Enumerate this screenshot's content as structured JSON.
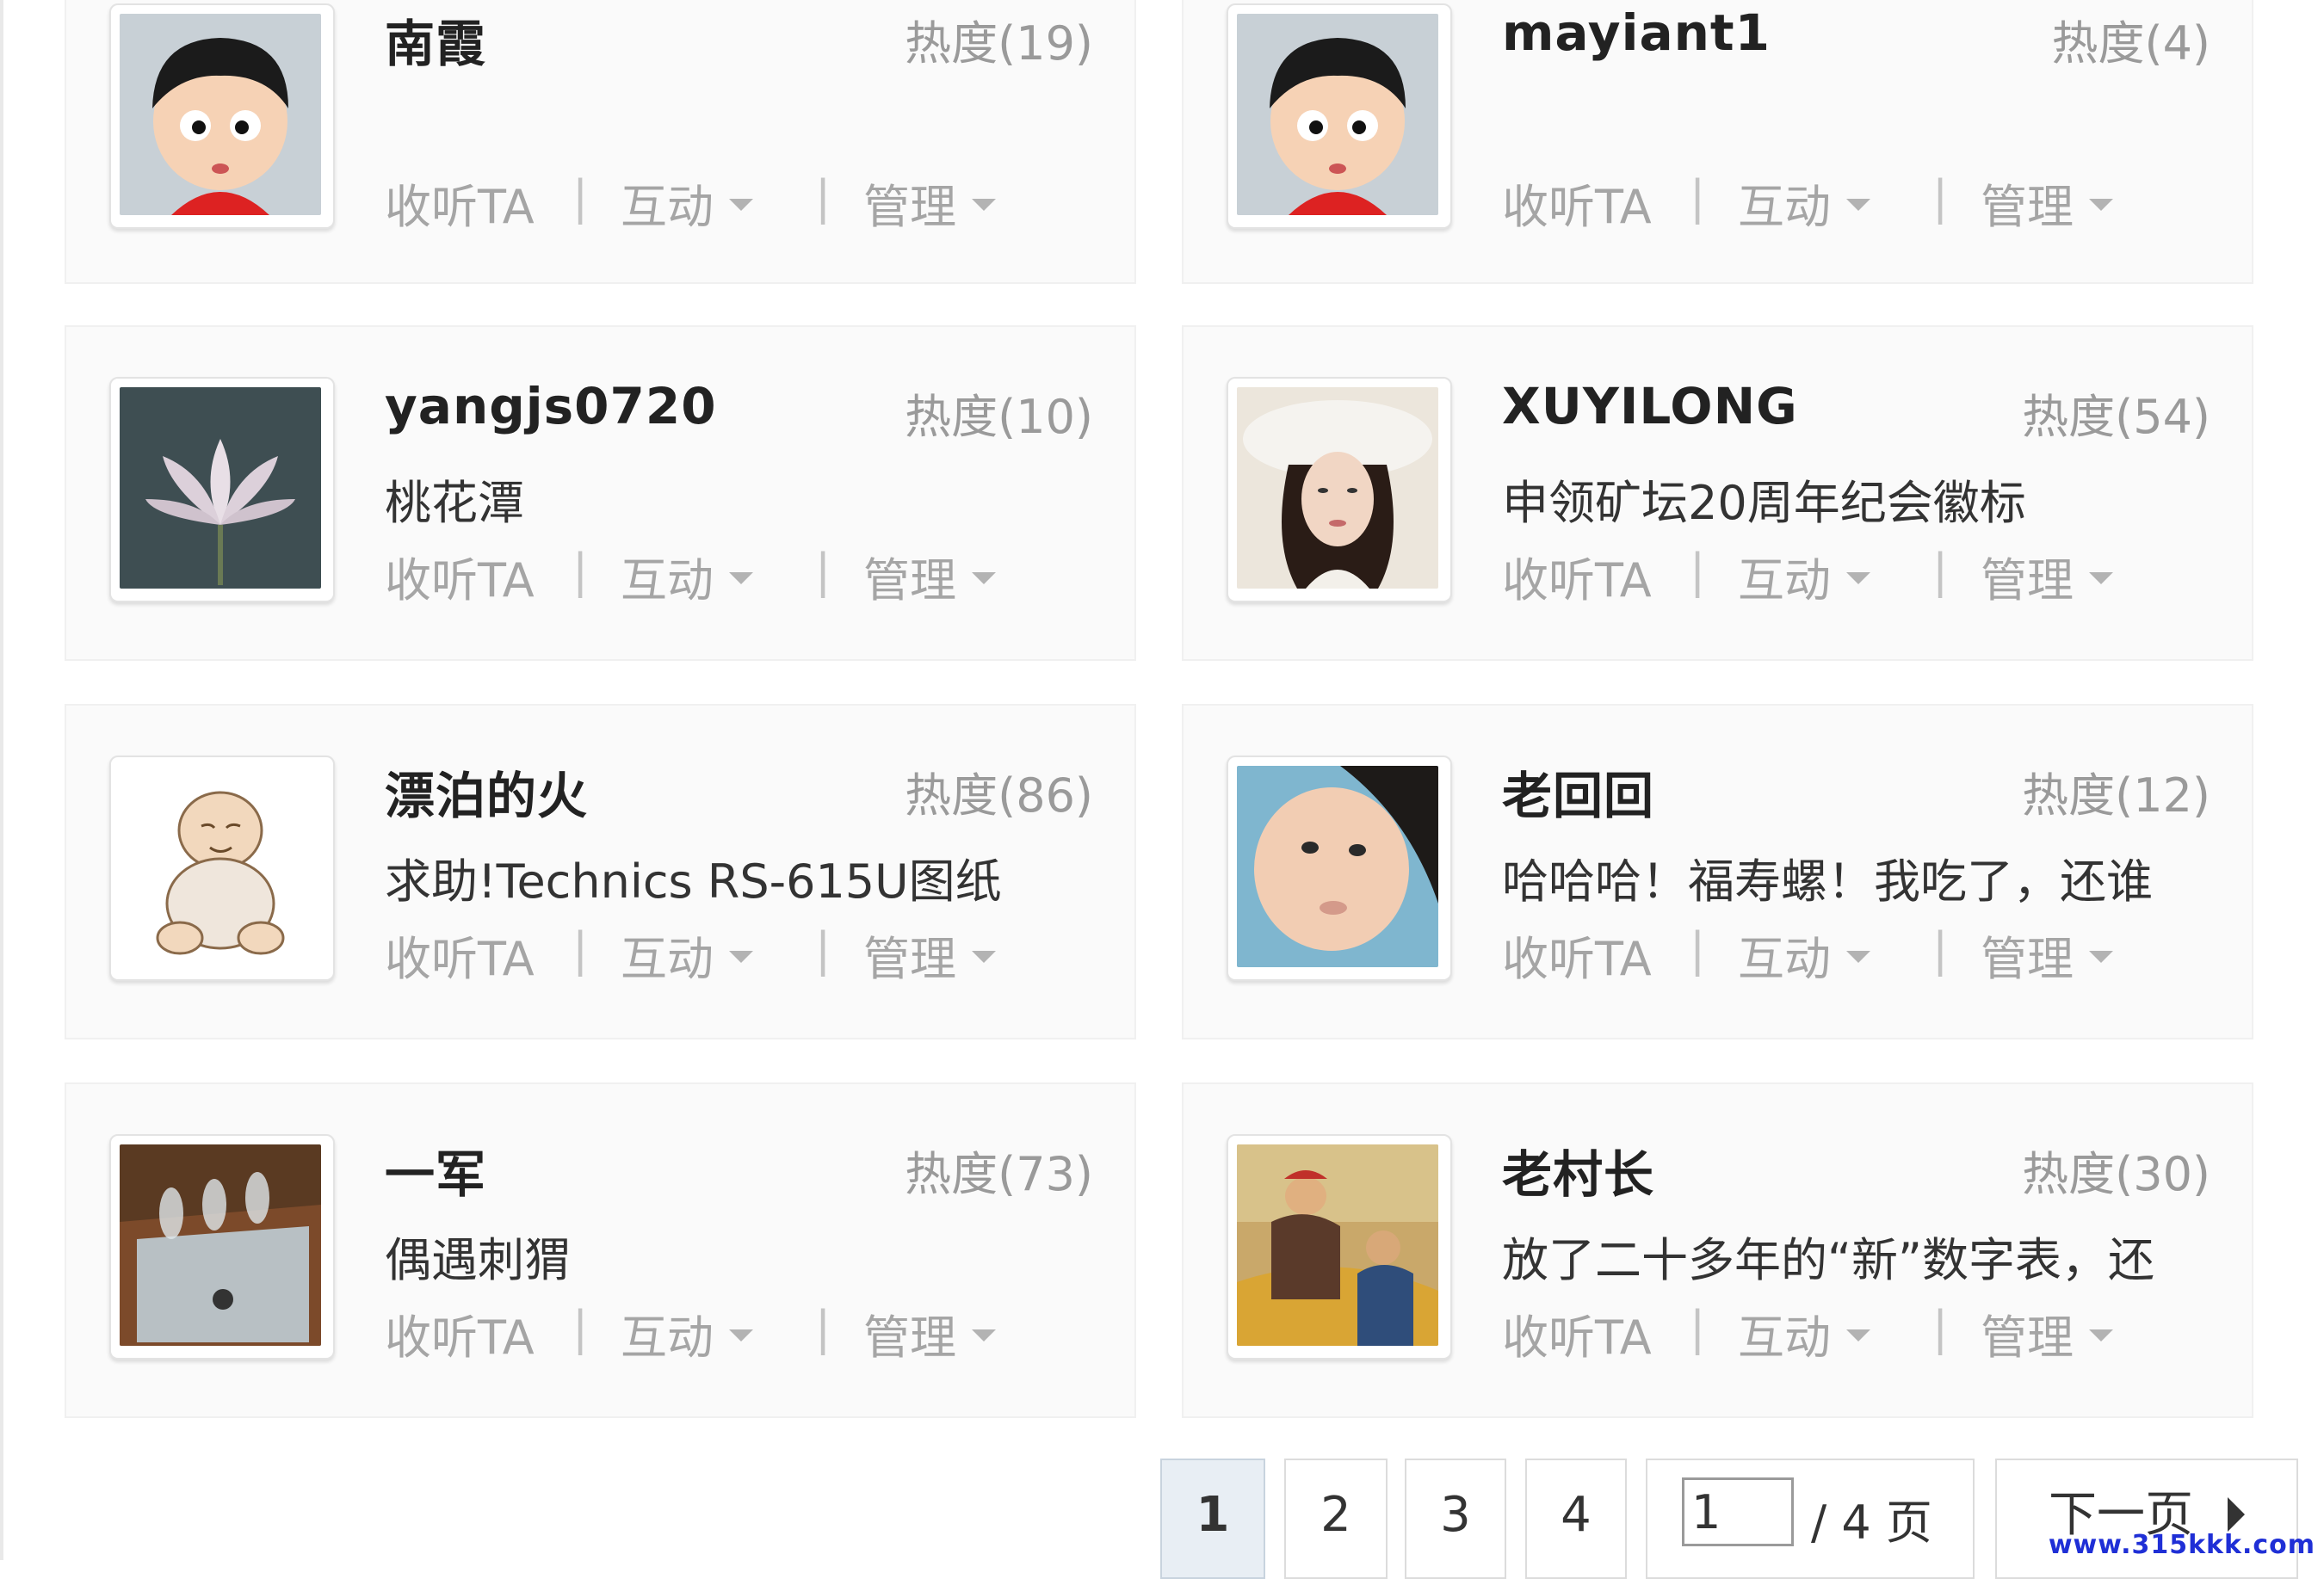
{
  "users": [
    {
      "name": "南霞",
      "heat": "热度(19)",
      "bio": "",
      "avatar": "cartoon-boy-avatar"
    },
    {
      "name": "mayiant1",
      "heat": "热度(4)",
      "bio": "",
      "avatar": "cartoon-boy-avatar"
    },
    {
      "name": "yangjs0720",
      "heat": "热度(10)",
      "bio": "桃花潭",
      "avatar": "lotus-flower-avatar"
    },
    {
      "name": "XUYILONG",
      "heat": "热度(54)",
      "bio": "申领矿坛20周年纪会徽标",
      "avatar": "woman-in-hat-avatar"
    },
    {
      "name": "漂泊的火",
      "heat": "热度(86)",
      "bio": "求助!Technics RS-615U图纸",
      "avatar": "sketch-baby-avatar"
    },
    {
      "name": "老回回",
      "heat": "热度(12)",
      "bio": "哈哈哈！福寿螺！我吃了，还谁",
      "avatar": "baby-photo-avatar"
    },
    {
      "name": "一军",
      "heat": "热度(73)",
      "bio": "偶遇刺猬",
      "avatar": "tube-amp-avatar"
    },
    {
      "name": "老村长",
      "heat": "热度(30)",
      "bio": "放了二十多年的“新”数字表，还",
      "avatar": "painting-avatar"
    }
  ],
  "actions": {
    "listen": "收听TA",
    "interact": "互动",
    "manage": "管理",
    "separator": "|"
  },
  "pagination": {
    "pages": [
      "1",
      "2",
      "3",
      "4"
    ],
    "current": "1",
    "goto_value": "1",
    "total_label": "/ 4 页",
    "next_label": "下一页"
  },
  "watermark": "www.315kkk.com",
  "colors": {
    "card_bg": "#fafafa",
    "heat": "#9a9a9a",
    "action": "#a5a5a5",
    "current_page_bg": "#e8eef4"
  }
}
